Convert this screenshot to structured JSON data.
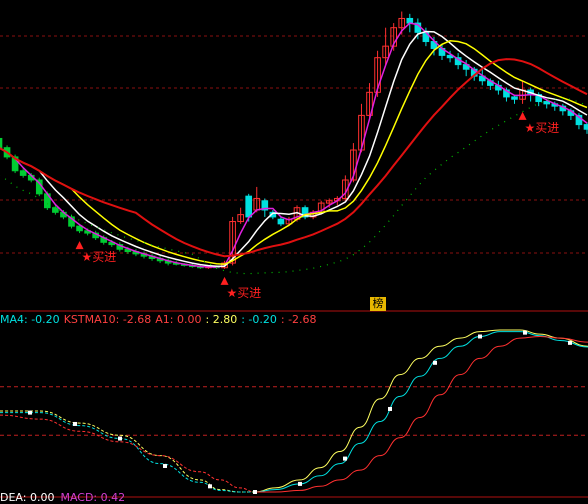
{
  "chart_data": [
    {
      "type": "candlestick",
      "panel": "price",
      "annotations": [
        {
          "text": "买进",
          "index": 10,
          "color": "#ff2020"
        },
        {
          "text": "买进",
          "index": 28,
          "color": "#ff2020"
        },
        {
          "text": "买进",
          "index": 65,
          "color": "#ff2020"
        }
      ],
      "candles": [
        {
          "o": 100,
          "c": 96,
          "h": 101,
          "l": 95
        },
        {
          "o": 96,
          "c": 92,
          "h": 97,
          "l": 91
        },
        {
          "o": 92,
          "c": 86,
          "h": 93,
          "l": 85
        },
        {
          "o": 86,
          "c": 84,
          "h": 87,
          "l": 83
        },
        {
          "o": 84,
          "c": 82,
          "h": 85,
          "l": 81
        },
        {
          "o": 82,
          "c": 76,
          "h": 83,
          "l": 75
        },
        {
          "o": 76,
          "c": 70,
          "h": 77,
          "l": 69
        },
        {
          "o": 70,
          "c": 68,
          "h": 71,
          "l": 67
        },
        {
          "o": 68,
          "c": 66,
          "h": 69,
          "l": 65
        },
        {
          "o": 66,
          "c": 62,
          "h": 67,
          "l": 61
        },
        {
          "o": 62,
          "c": 60,
          "h": 63,
          "l": 59
        },
        {
          "o": 60,
          "c": 59,
          "h": 61,
          "l": 58
        },
        {
          "o": 59,
          "c": 57,
          "h": 60,
          "l": 56
        },
        {
          "o": 57,
          "c": 55,
          "h": 58,
          "l": 54
        },
        {
          "o": 55,
          "c": 54,
          "h": 56,
          "l": 53
        },
        {
          "o": 54,
          "c": 52,
          "h": 55,
          "l": 51
        },
        {
          "o": 52,
          "c": 51,
          "h": 53,
          "l": 50
        },
        {
          "o": 51,
          "c": 50,
          "h": 52,
          "l": 49
        },
        {
          "o": 50,
          "c": 49,
          "h": 51,
          "l": 48
        },
        {
          "o": 49,
          "c": 48,
          "h": 50,
          "l": 47
        },
        {
          "o": 48,
          "c": 47,
          "h": 49,
          "l": 46
        },
        {
          "o": 47,
          "c": 46,
          "h": 48,
          "l": 45
        },
        {
          "o": 46,
          "c": 45.5,
          "h": 47,
          "l": 45
        },
        {
          "o": 45.5,
          "c": 45,
          "h": 46,
          "l": 44.5
        },
        {
          "o": 45,
          "c": 44.5,
          "h": 46,
          "l": 44
        },
        {
          "o": 44.5,
          "c": 44,
          "h": 45,
          "l": 43.5
        },
        {
          "o": 44,
          "c": 44.5,
          "h": 45,
          "l": 43.5
        },
        {
          "o": 44.5,
          "c": 44,
          "h": 45,
          "l": 43.5
        },
        {
          "o": 44,
          "c": 46,
          "h": 47,
          "l": 43.5
        },
        {
          "o": 46,
          "c": 64,
          "h": 66,
          "l": 45
        },
        {
          "o": 64,
          "c": 67,
          "h": 70,
          "l": 63
        },
        {
          "o": 75,
          "c": 66,
          "h": 76,
          "l": 64
        },
        {
          "o": 69,
          "c": 74,
          "h": 79,
          "l": 68
        },
        {
          "o": 73,
          "c": 69,
          "h": 74,
          "l": 66
        },
        {
          "o": 68,
          "c": 66,
          "h": 69,
          "l": 65
        },
        {
          "o": 65,
          "c": 63,
          "h": 66,
          "l": 62
        },
        {
          "o": 63,
          "c": 65,
          "h": 66,
          "l": 62
        },
        {
          "o": 65,
          "c": 70,
          "h": 71,
          "l": 64
        },
        {
          "o": 70,
          "c": 66,
          "h": 71,
          "l": 65
        },
        {
          "o": 66,
          "c": 68,
          "h": 69,
          "l": 65
        },
        {
          "o": 68,
          "c": 72,
          "h": 73,
          "l": 67
        },
        {
          "o": 72,
          "c": 73,
          "h": 74,
          "l": 70
        },
        {
          "o": 73,
          "c": 74,
          "h": 75,
          "l": 71
        },
        {
          "o": 74,
          "c": 82,
          "h": 84,
          "l": 73
        },
        {
          "o": 82,
          "c": 95,
          "h": 98,
          "l": 81
        },
        {
          "o": 95,
          "c": 110,
          "h": 115,
          "l": 94
        },
        {
          "o": 110,
          "c": 120,
          "h": 124,
          "l": 108
        },
        {
          "o": 120,
          "c": 135,
          "h": 138,
          "l": 118
        },
        {
          "o": 135,
          "c": 140,
          "h": 148,
          "l": 132
        },
        {
          "o": 140,
          "c": 148,
          "h": 150,
          "l": 138
        },
        {
          "o": 148,
          "c": 152,
          "h": 155,
          "l": 145
        },
        {
          "o": 152,
          "c": 150,
          "h": 154,
          "l": 146
        },
        {
          "o": 150,
          "c": 146,
          "h": 152,
          "l": 143
        },
        {
          "o": 146,
          "c": 142,
          "h": 148,
          "l": 140
        },
        {
          "o": 142,
          "c": 139,
          "h": 144,
          "l": 136
        },
        {
          "o": 139,
          "c": 136,
          "h": 141,
          "l": 134
        },
        {
          "o": 136,
          "c": 135,
          "h": 138,
          "l": 133
        },
        {
          "o": 135,
          "c": 132,
          "h": 137,
          "l": 130
        },
        {
          "o": 132,
          "c": 130,
          "h": 134,
          "l": 127
        },
        {
          "o": 130,
          "c": 127,
          "h": 131,
          "l": 125
        },
        {
          "o": 127,
          "c": 125,
          "h": 130,
          "l": 123
        },
        {
          "o": 125,
          "c": 123,
          "h": 126,
          "l": 121
        },
        {
          "o": 123,
          "c": 121,
          "h": 125,
          "l": 119
        },
        {
          "o": 121,
          "c": 118,
          "h": 122,
          "l": 116
        },
        {
          "o": 118,
          "c": 117,
          "h": 119,
          "l": 115
        },
        {
          "o": 117,
          "c": 121,
          "h": 125,
          "l": 115
        },
        {
          "o": 121,
          "c": 119,
          "h": 122,
          "l": 116
        },
        {
          "o": 119,
          "c": 116,
          "h": 120,
          "l": 114
        },
        {
          "o": 116,
          "c": 115,
          "h": 117,
          "l": 113
        },
        {
          "o": 115,
          "c": 114,
          "h": 116,
          "l": 112
        },
        {
          "o": 114,
          "c": 112,
          "h": 115,
          "l": 110
        },
        {
          "o": 112,
          "c": 110,
          "h": 113,
          "l": 108
        },
        {
          "o": 110,
          "c": 106,
          "h": 111,
          "l": 104
        },
        {
          "o": 106,
          "c": 104,
          "h": 107,
          "l": 102
        }
      ]
    },
    {
      "type": "line",
      "panel": "indicator",
      "labels": [
        {
          "text": "MA4: -0.20",
          "color": "#00e0e0"
        },
        {
          "text": "KSTMA10: -2.68",
          "color": "#ff4040"
        },
        {
          "text": "A1: 0.00",
          "color": "#ff4040"
        },
        {
          "text": ": 2.80",
          "color": "#ffff60"
        },
        {
          "text": ": -0.20",
          "color": "#00e0e0"
        },
        {
          "text": ": -2.68",
          "color": "#ff4040"
        }
      ],
      "reference_lines": [
        {
          "y": 3,
          "style": "dashed",
          "color": "#c02020"
        },
        {
          "y": -3,
          "style": "dashed",
          "color": "#c02020"
        }
      ],
      "ylim": [
        -10,
        10
      ],
      "series": [
        {
          "color": "#ffff60",
          "x": [
            0,
            40,
            80,
            120,
            160,
            200,
            220,
            240,
            255,
            275,
            300,
            320,
            340,
            360,
            380,
            400,
            420,
            440,
            460,
            480,
            500,
            520,
            540,
            560,
            588
          ],
          "values": [
            0,
            0,
            -1.5,
            -3,
            -5.5,
            -8.5,
            -9.7,
            -10,
            -10,
            -9.5,
            -8.5,
            -7,
            -5,
            -2,
            1.5,
            4.5,
            6.5,
            8,
            9,
            9.8,
            10,
            10,
            9.5,
            9,
            8
          ]
        },
        {
          "color": "#00e0e0",
          "x": [
            0,
            40,
            80,
            120,
            160,
            200,
            220,
            240,
            255,
            275,
            300,
            320,
            340,
            360,
            380,
            400,
            420,
            440,
            460,
            480,
            500,
            520,
            540,
            560,
            588
          ],
          "values": [
            -0.2,
            -0.2,
            -1.8,
            -3.4,
            -6.5,
            -8.8,
            -9.8,
            -10,
            -10,
            -9.7,
            -9,
            -8,
            -6.5,
            -4,
            -1.3,
            1.8,
            4.3,
            6.5,
            8,
            9.2,
            9.8,
            9.8,
            9.3,
            8.7,
            7.9
          ]
        },
        {
          "color": "#ff3030",
          "x": [
            0,
            40,
            80,
            120,
            160,
            200,
            220,
            240,
            255,
            275,
            300,
            320,
            340,
            360,
            380,
            400,
            420,
            440,
            460,
            480,
            500,
            520,
            540,
            560,
            588
          ],
          "values": [
            -0.5,
            -1,
            -2.5,
            -3.8,
            -5.5,
            -7.5,
            -8.5,
            -9.5,
            -10,
            -10,
            -9.8,
            -9.3,
            -8.5,
            -7.3,
            -5.5,
            -3.3,
            -0.8,
            2,
            4.5,
            6.5,
            8,
            9,
            9.2,
            9,
            8.5
          ]
        }
      ],
      "markers": {
        "x": [
          30,
          75,
          120,
          165,
          210,
          255,
          300,
          345,
          390,
          435,
          480,
          525,
          570
        ],
        "color": "#ffffff"
      }
    }
  ],
  "bottom_bar": [
    {
      "text": "DEA: 0.00",
      "color": "#ffffff"
    },
    {
      "text": "MACD: 0.42",
      "color": "#d040d0"
    }
  ],
  "tag": "榜"
}
